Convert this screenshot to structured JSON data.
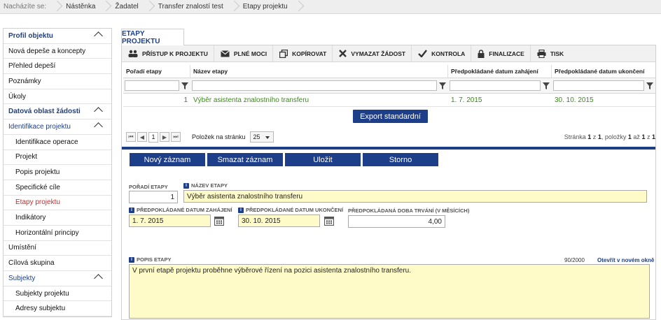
{
  "breadcrumb": {
    "lead": "Nacházíte se:",
    "items": [
      "Nástěnka",
      "Žadatel",
      "Transfer znalostí test",
      "Etapy projektu"
    ]
  },
  "sidebar": {
    "items": [
      {
        "label": "Profil objektu"
      },
      {
        "label": "Nová depeše a koncepty"
      },
      {
        "label": "Přehled depeší"
      },
      {
        "label": "Poznámky"
      },
      {
        "label": "Úkoly"
      },
      {
        "label": "Datová oblast žádosti"
      },
      {
        "label": "Identifikace projektu"
      },
      {
        "label": "Identifikace operace"
      },
      {
        "label": "Projekt"
      },
      {
        "label": "Popis projektu"
      },
      {
        "label": "Specifické cíle"
      },
      {
        "label": "Etapy projektu"
      },
      {
        "label": "Indikátory"
      },
      {
        "label": "Horizontální principy"
      },
      {
        "label": "Umístění"
      },
      {
        "label": "Cílová skupina"
      },
      {
        "label": "Subjekty"
      },
      {
        "label": "Subjekty projektu"
      },
      {
        "label": "Adresy subjektu"
      }
    ]
  },
  "tab": {
    "label": "ETAPY PROJEKTU"
  },
  "toolbar": {
    "access": "Přístup k projektu",
    "proxy": "Plné moci",
    "copy": "Kopírovat",
    "delete": "Vymazat žádost",
    "check": "Kontrola",
    "finalize": "Finalizace",
    "print": "Tisk"
  },
  "grid": {
    "columns": [
      "Pořadí etapy",
      "Název etapy",
      "Předpokládané datum zahájení",
      "Předpokládané datum ukončení"
    ],
    "rows": [
      {
        "order": "1",
        "name": "Výběr asistenta znalostního transferu",
        "start": "1. 7. 2015",
        "end": "30. 10. 2015"
      }
    ]
  },
  "export_label": "Export standardní",
  "pager": {
    "page": "1",
    "per_page_label": "Položek na stránku",
    "per_page": "25",
    "info_prefix": "Stránka",
    "info_page": "1",
    "info_of": "z",
    "info_pages": "1",
    "info_items_label": ", položky",
    "info_from": "1",
    "info_to_label": "až",
    "info_to": "1",
    "info_total_of": "z",
    "info_total": "1"
  },
  "actions": {
    "new": "Nový záznam",
    "delete": "Smazat záznam",
    "save": "Uložit",
    "cancel": "Storno"
  },
  "form": {
    "order_label": "Pořadí etapy",
    "order_value": "1",
    "name_label": "Název etapy",
    "name_value": "Výběr asistenta znalostního transferu",
    "start_label": "Předpokládané datum zahájení",
    "start_value": "1. 7. 2015",
    "end_label": "Předpokládané datum ukončení",
    "end_value": "30. 10. 2015",
    "duration_label": "Předpokládaná doba trvání (v měsících)",
    "duration_value": "4,00",
    "description_label": "Popis etapy",
    "description_counter": "90/2000",
    "description_open_link": "Otevřít v novém okně",
    "description_value": "V první etapě projektu proběhne výběrové řízení na pozici asistenta znalostního transferu."
  },
  "colors": {
    "accent": "#1d3f8a",
    "active_nav": "#cc2a2a",
    "row_text": "#3a8a1a",
    "required_field": "#fffbc8"
  }
}
